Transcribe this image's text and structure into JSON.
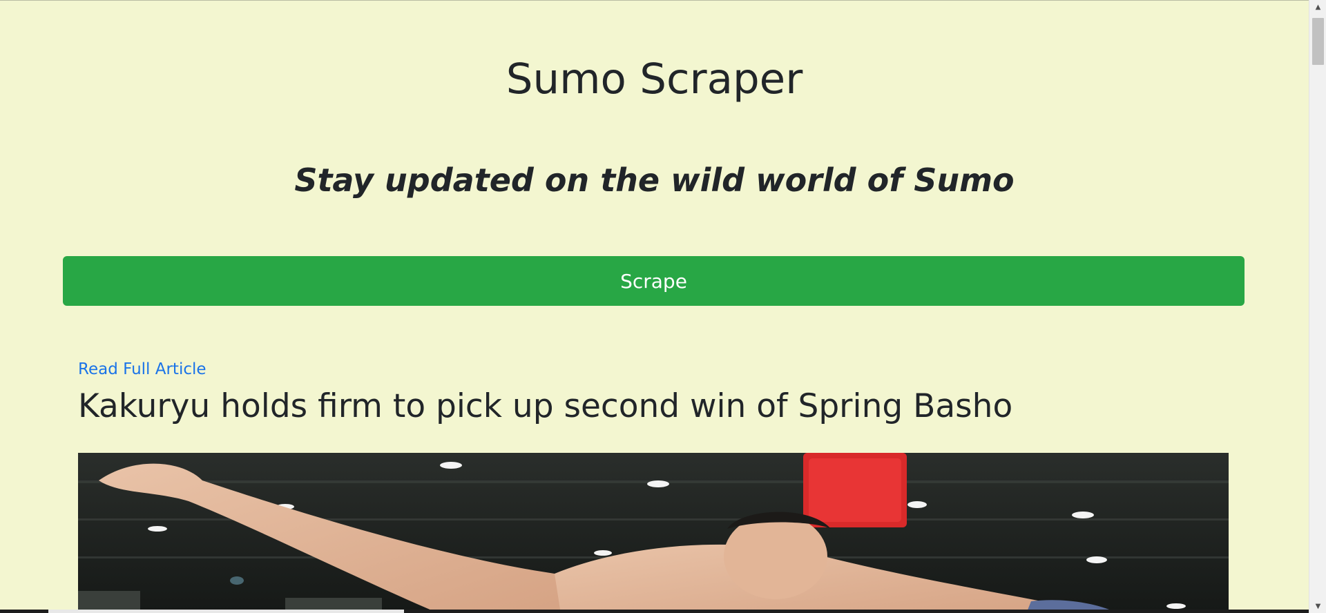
{
  "header": {
    "title": "Sumo Scraper",
    "tagline": "Stay updated on the wild world of Sumo"
  },
  "actions": {
    "scrape_label": "Scrape"
  },
  "articles": [
    {
      "link_text": "Read Full Article",
      "title": "Kakuryu holds firm to pick up second win of Spring Basho"
    }
  ],
  "colors": {
    "background": "#f3f6d0",
    "button": "#28a745",
    "link": "#1a73e8",
    "text": "#212529"
  },
  "icons": {
    "scroll_up": "triangle-up",
    "scroll_down": "triangle-down"
  }
}
